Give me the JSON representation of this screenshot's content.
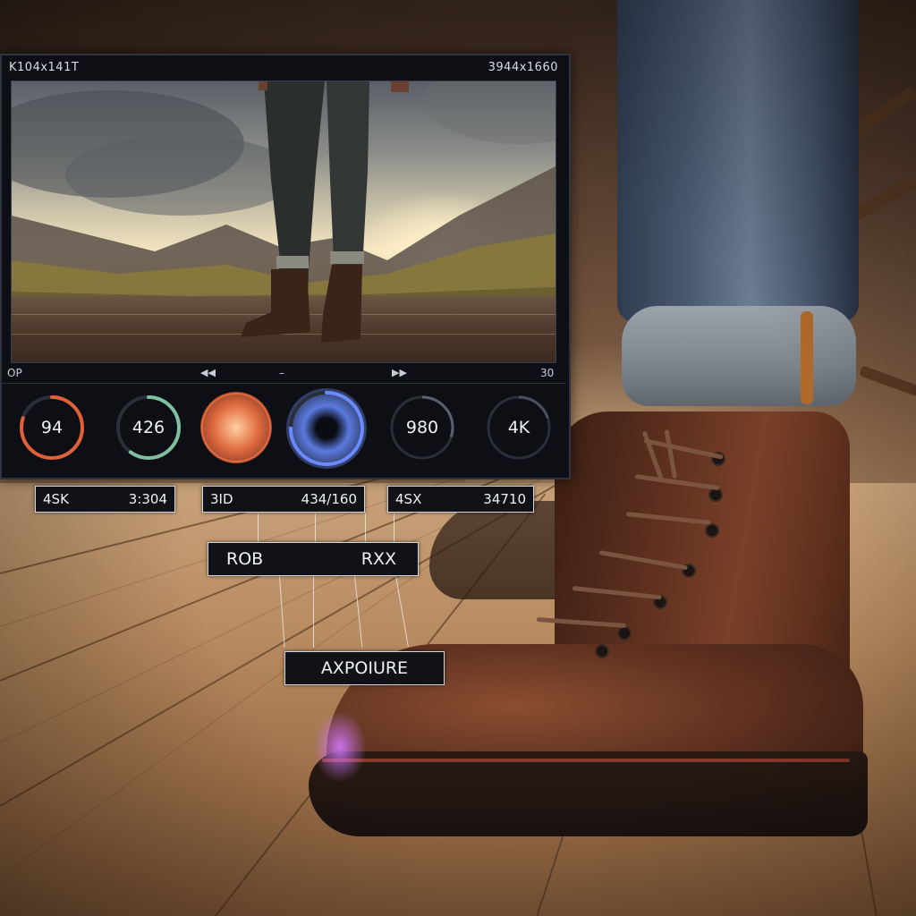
{
  "monitor": {
    "title_left": "K104x141T",
    "title_right": "3944x1660",
    "transport": {
      "left": "OP",
      "rewind_icon": "rewind-icon",
      "center_icon": "minus-icon",
      "forward_icon": "forward-icon",
      "right": "30"
    },
    "dials": [
      {
        "label": "94",
        "color": "#e0603a",
        "level": 0.8
      },
      {
        "label": "426",
        "color": "#7fc0a0",
        "level": 0.6
      },
      {
        "label": "",
        "color": "#e06a40",
        "level": 1.0
      },
      {
        "label": "",
        "color": "#6a8aff",
        "level": 0.75
      },
      {
        "label": "980",
        "color": "#5a6070",
        "level": 0.3
      },
      {
        "label": "4K",
        "color": "#4a5060",
        "level": 0.2
      }
    ]
  },
  "tags": {
    "tag1": {
      "left": "4SK",
      "right": "3:304"
    },
    "tag2": {
      "left": "3ID",
      "right": "434/160"
    },
    "tag3": {
      "left": "4SX",
      "right": "34710"
    },
    "tag4": {
      "left": "ROB",
      "right": "RXX"
    },
    "tag5": {
      "text": "AXPOIURE"
    }
  },
  "colors": {
    "panel": "#0d0f14",
    "tag_border": "#cfd6e0",
    "boot_leather": "#5e3020"
  }
}
